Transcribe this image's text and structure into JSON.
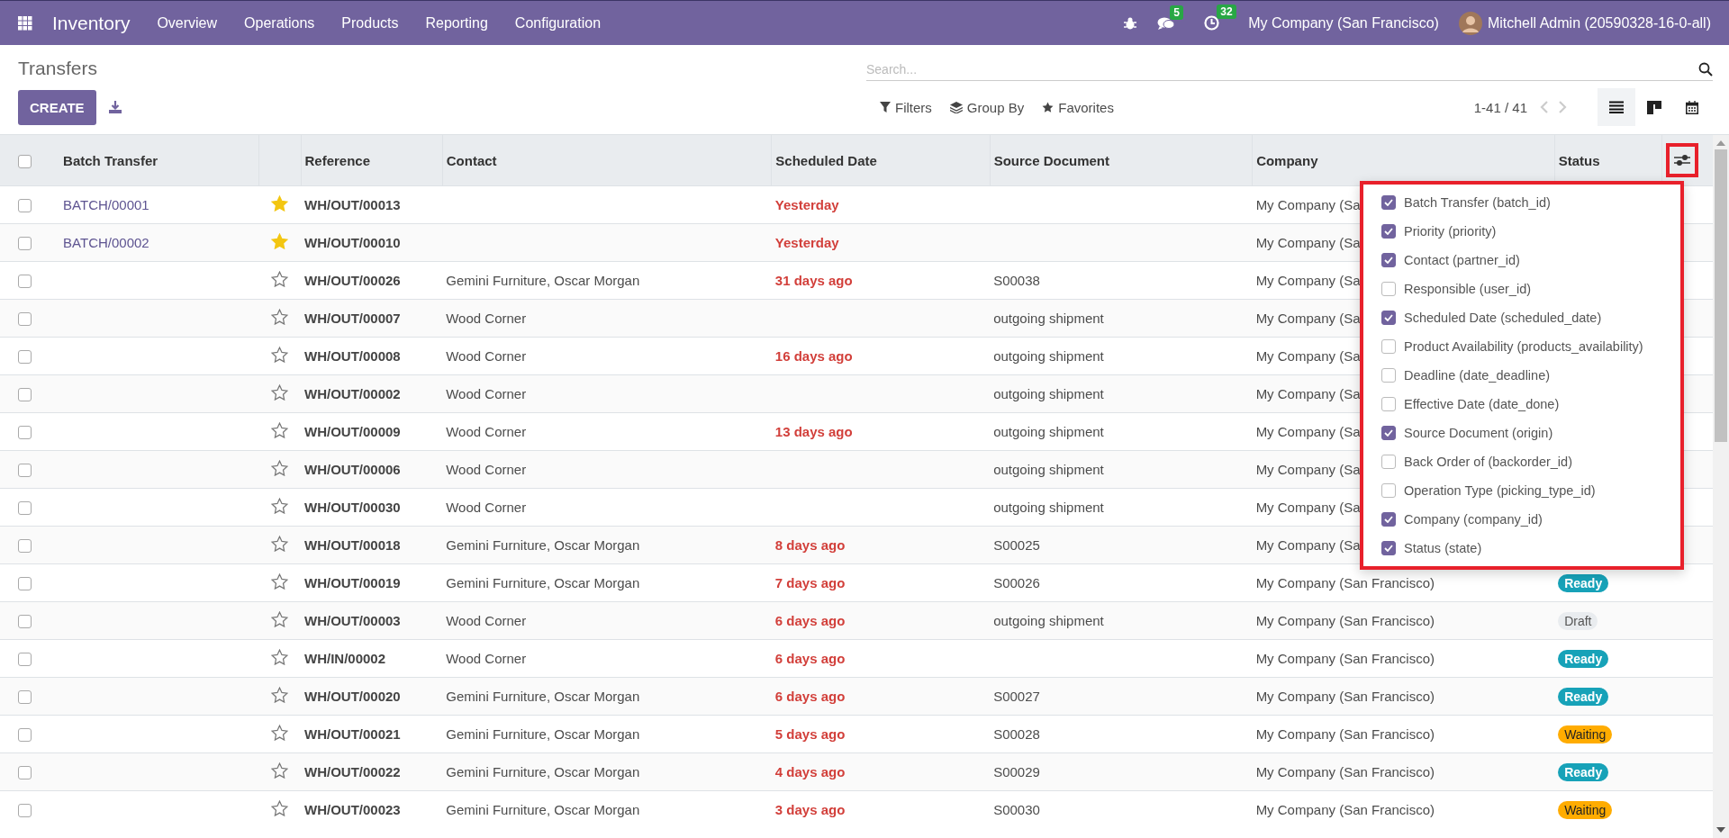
{
  "navbar": {
    "app_name": "Inventory",
    "menu": [
      "Overview",
      "Operations",
      "Products",
      "Reporting",
      "Configuration"
    ],
    "chat_count": "5",
    "activity_count": "32",
    "company": "My Company (San Francisco)",
    "user": "Mitchell Admin (20590328-16-0-all)"
  },
  "control_panel": {
    "title": "Transfers",
    "create_label": "CREATE",
    "search_placeholder": "Search...",
    "filters": [
      {
        "kind": "filter",
        "label": "Filters"
      },
      {
        "kind": "group",
        "label": "Group By"
      },
      {
        "kind": "favorite",
        "label": "Favorites"
      }
    ],
    "pager": "1-41 / 41",
    "views": [
      {
        "kind": "list",
        "selected": true
      },
      {
        "kind": "kanban",
        "selected": false
      },
      {
        "kind": "calendar",
        "selected": false
      }
    ]
  },
  "table": {
    "all_selected": false,
    "columns": [
      "Batch Transfer",
      "Reference",
      "Contact",
      "Scheduled Date",
      "Source Document",
      "Company",
      "Status"
    ],
    "rows": [
      {
        "selected": false,
        "batch": "BATCH/00001",
        "starred": true,
        "reference": "WH/OUT/00013",
        "contact": "",
        "scheduled": "Yesterday",
        "source": "",
        "company": "My Company (Sa"
      },
      {
        "selected": false,
        "batch": "BATCH/00002",
        "starred": true,
        "reference": "WH/OUT/00010",
        "contact": "",
        "scheduled": "Yesterday",
        "source": "",
        "company": "My Company (Sa"
      },
      {
        "selected": false,
        "batch": "",
        "starred": false,
        "reference": "WH/OUT/00026",
        "contact": "Gemini Furniture, Oscar Morgan",
        "scheduled": "31 days ago",
        "source": "S00038",
        "company": "My Company (Sa"
      },
      {
        "selected": false,
        "batch": "",
        "starred": false,
        "reference": "WH/OUT/00007",
        "contact": "Wood Corner",
        "scheduled": "",
        "source": "outgoing shipment",
        "company": "My Company (Sa"
      },
      {
        "selected": false,
        "batch": "",
        "starred": false,
        "reference": "WH/OUT/00008",
        "contact": "Wood Corner",
        "scheduled": "16 days ago",
        "source": "outgoing shipment",
        "company": "My Company (Sa"
      },
      {
        "selected": false,
        "batch": "",
        "starred": false,
        "reference": "WH/OUT/00002",
        "contact": "Wood Corner",
        "scheduled": "",
        "source": "outgoing shipment",
        "company": "My Company (Sa"
      },
      {
        "selected": false,
        "batch": "",
        "starred": false,
        "reference": "WH/OUT/00009",
        "contact": "Wood Corner",
        "scheduled": "13 days ago",
        "source": "outgoing shipment",
        "company": "My Company (Sa"
      },
      {
        "selected": false,
        "batch": "",
        "starred": false,
        "reference": "WH/OUT/00006",
        "contact": "Wood Corner",
        "scheduled": "",
        "source": "outgoing shipment",
        "company": "My Company (Sa"
      },
      {
        "selected": false,
        "batch": "",
        "starred": false,
        "reference": "WH/OUT/00030",
        "contact": "Wood Corner",
        "scheduled": "",
        "source": "outgoing shipment",
        "company": "My Company (Sa"
      },
      {
        "selected": false,
        "batch": "",
        "starred": false,
        "reference": "WH/OUT/00018",
        "contact": "Gemini Furniture, Oscar Morgan",
        "scheduled": "8 days ago",
        "source": "S00025",
        "company": "My Company (Sa"
      },
      {
        "selected": false,
        "batch": "",
        "starred": false,
        "reference": "WH/OUT/00019",
        "contact": "Gemini Furniture, Oscar Morgan",
        "scheduled": "7 days ago",
        "source": "S00026",
        "company": "My Company (San Francisco)",
        "status": {
          "kind": "ready",
          "label": "Ready"
        }
      },
      {
        "selected": false,
        "batch": "",
        "starred": false,
        "reference": "WH/OUT/00003",
        "contact": "Wood Corner",
        "scheduled": "6 days ago",
        "source": "outgoing shipment",
        "company": "My Company (San Francisco)",
        "status": {
          "kind": "draft",
          "label": "Draft"
        }
      },
      {
        "selected": false,
        "batch": "",
        "starred": false,
        "reference": "WH/IN/00002",
        "contact": "Wood Corner",
        "scheduled": "6 days ago",
        "source": "",
        "company": "My Company (San Francisco)",
        "status": {
          "kind": "ready",
          "label": "Ready"
        }
      },
      {
        "selected": false,
        "batch": "",
        "starred": false,
        "reference": "WH/OUT/00020",
        "contact": "Gemini Furniture, Oscar Morgan",
        "scheduled": "6 days ago",
        "source": "S00027",
        "company": "My Company (San Francisco)",
        "status": {
          "kind": "ready",
          "label": "Ready"
        }
      },
      {
        "selected": false,
        "batch": "",
        "starred": false,
        "reference": "WH/OUT/00021",
        "contact": "Gemini Furniture, Oscar Morgan",
        "scheduled": "5 days ago",
        "source": "S00028",
        "company": "My Company (San Francisco)",
        "status": {
          "kind": "waiting",
          "label": "Waiting"
        }
      },
      {
        "selected": false,
        "batch": "",
        "starred": false,
        "reference": "WH/OUT/00022",
        "contact": "Gemini Furniture, Oscar Morgan",
        "scheduled": "4 days ago",
        "source": "S00029",
        "company": "My Company (San Francisco)",
        "status": {
          "kind": "ready",
          "label": "Ready"
        }
      },
      {
        "selected": false,
        "batch": "",
        "starred": false,
        "reference": "WH/OUT/00023",
        "contact": "Gemini Furniture, Oscar Morgan",
        "scheduled": "3 days ago",
        "source": "S00030",
        "company": "My Company (San Francisco)",
        "status": {
          "kind": "waiting",
          "label": "Waiting"
        }
      }
    ]
  },
  "optional_columns": [
    {
      "label": "Batch Transfer (batch_id)",
      "checked": true
    },
    {
      "label": "Priority (priority)",
      "checked": true
    },
    {
      "label": "Contact (partner_id)",
      "checked": true
    },
    {
      "label": "Responsible (user_id)",
      "checked": false
    },
    {
      "label": "Scheduled Date (scheduled_date)",
      "checked": true
    },
    {
      "label": "Product Availability (products_availability)",
      "checked": false
    },
    {
      "label": "Deadline (date_deadline)",
      "checked": false
    },
    {
      "label": "Effective Date (date_done)",
      "checked": false
    },
    {
      "label": "Source Document (origin)",
      "checked": true
    },
    {
      "label": "Back Order of (backorder_id)",
      "checked": false
    },
    {
      "label": "Operation Type (picking_type_id)",
      "checked": false
    },
    {
      "label": "Company (company_id)",
      "checked": true
    },
    {
      "label": "Status (state)",
      "checked": true
    }
  ]
}
